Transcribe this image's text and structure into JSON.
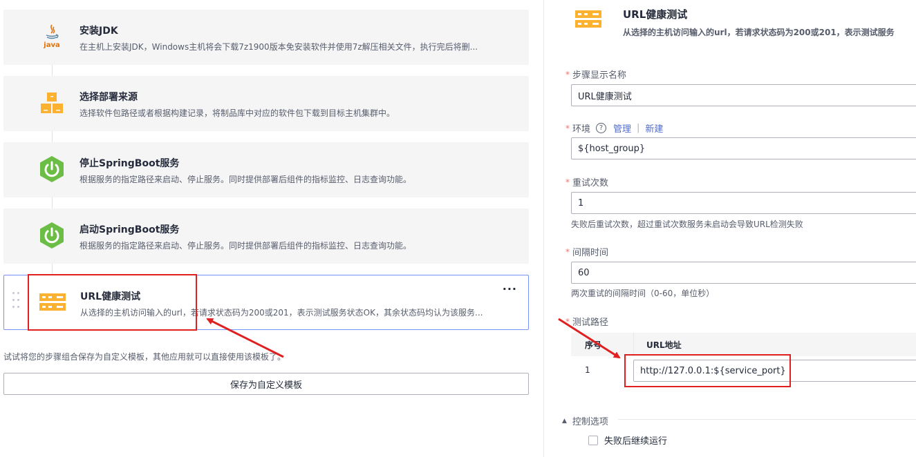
{
  "steps": [
    {
      "title": "安装JDK",
      "desc": "在主机上安装JDK，Windows主机将会下载7z1900版本免安装软件并使用7z解压相关文件，执行完后将删...",
      "icon": "java-icon"
    },
    {
      "title": "选择部署来源",
      "desc": "选择软件包路径或者根据构建记录，将制品库中对应的软件包下载到目标主机集群中。",
      "icon": "boxes-icon"
    },
    {
      "title": "停止SpringBoot服务",
      "desc": "根据服务的指定路径来启动、停止服务。同时提供部署后组件的指标监控、日志查询功能。",
      "icon": "springboot-power-icon"
    },
    {
      "title": "启动SpringBoot服务",
      "desc": "根据服务的指定路径来启动、停止服务。同时提供部署后组件的指标监控、日志查询功能。",
      "icon": "springboot-power-icon"
    },
    {
      "title": "URL健康测试",
      "desc": "从选择的主机访问输入的url，若请求状态码为200或201，表示测试服务状态OK，其余状态码均认为该服务...",
      "icon": "server-icon"
    }
  ],
  "more_label": "···",
  "hint": "试试将您的步骤组合保存为自定义模板，其他应用就可以直接使用该模板了。",
  "save_template_label": "保存为自定义模板",
  "detail": {
    "title": "URL健康测试",
    "desc": "从选择的主机访问输入的url，若请求状态码为200或201，表示测试服务",
    "required_mark": "*",
    "step_name_label": "步骤显示名称",
    "step_name_value": "URL健康测试",
    "env_label": "环境",
    "env_help_icon": "?",
    "env_manage": "管理",
    "env_sep": "|",
    "env_new": "新建",
    "env_value": "${host_group}",
    "retry_label": "重试次数",
    "retry_value": "1",
    "retry_help": "失败后重试次数，超过重试次数服务未启动会导致URL检测失败",
    "interval_label": "间隔时间",
    "interval_value": "60",
    "interval_help": "两次重试的间隔时间（0-60，单位秒）",
    "path_label": "测试路径",
    "table_headers": [
      "序号",
      "URL地址"
    ],
    "table_rows": [
      {
        "index": "1",
        "url": "http://127.0.0.1:${service_port}"
      }
    ],
    "control_label": "控制选项",
    "control_toggle": "▲",
    "continue_on_fail": "失败后继续运行"
  },
  "colors": {
    "accent": "#526ecc",
    "active_border": "#7693f5",
    "annotation_red": "#e02020",
    "icon_orange": "#fcb130",
    "spring_green": "#6cbd45"
  }
}
